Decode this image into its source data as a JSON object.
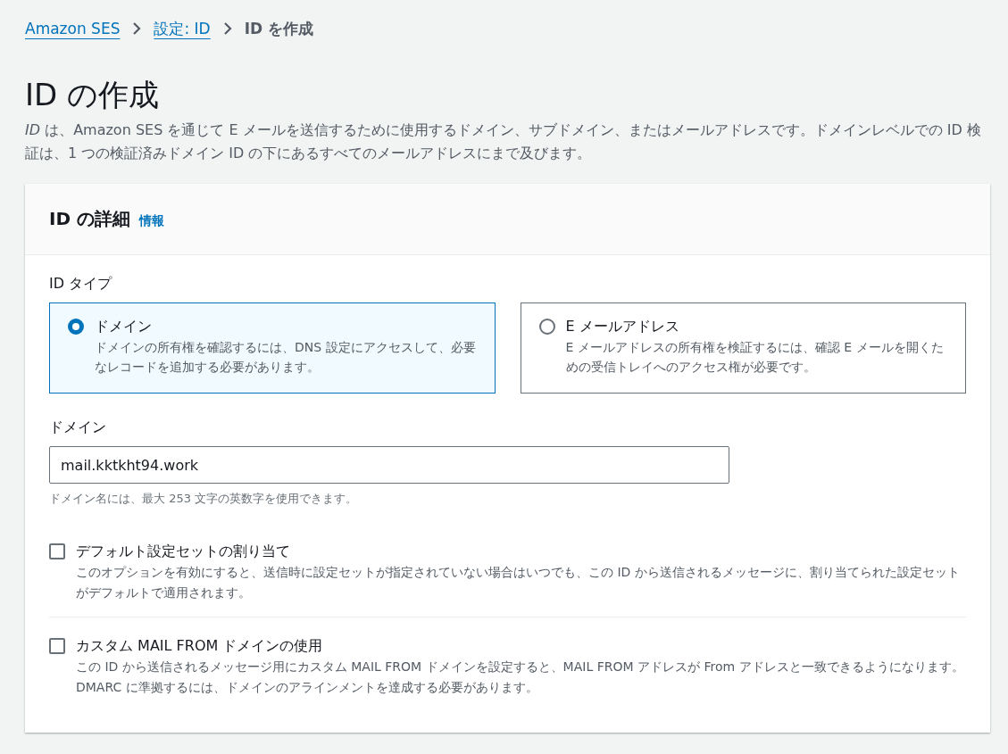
{
  "breadcrumbs": [
    {
      "label": "Amazon SES",
      "kind": "link"
    },
    {
      "label": "設定: ID",
      "kind": "link"
    },
    {
      "label": "ID を作成",
      "kind": "current"
    }
  ],
  "page": {
    "title": "ID の作成",
    "description": "*ID* は、Amazon SES を通じて E メールを送信するために使用するドメイン、サブドメイン、またはメールアドレスです。ドメインレベルでの ID 検証は、1 つの検証済みドメイン ID の下にあるすべてのメールアドレスにまで及びます。"
  },
  "card": {
    "title": "ID の詳細",
    "info_link": "情報",
    "id_type": {
      "label": "ID タイプ",
      "options": [
        {
          "label": "ドメイン",
          "description": "ドメインの所有権を確認するには、DNS 設定にアクセスして、必要なレコードを追加する必要があります。",
          "selected": true
        },
        {
          "label": "E メールアドレス",
          "description": "E メールアドレスの所有権を検証するには、確認 E メールを開くための受信トレイへのアクセス権が必要です。",
          "selected": false
        }
      ]
    },
    "domain": {
      "label": "ドメイン",
      "value": "mail.kktkht94.work",
      "hint": "ドメイン名には、最大 253 文字の英数字を使用できます。"
    },
    "options": [
      {
        "label": "デフォルト設定セットの割り当て",
        "description": "このオプションを有効にすると、送信時に設定セットが指定されていない場合はいつでも、この ID から送信されるメッセージに、割り当てられた設定セットがデフォルトで適用されます。",
        "checked": false
      },
      {
        "label": "カスタム MAIL FROM ドメインの使用",
        "description": "この ID から送信されるメッセージ用にカスタム MAIL FROM ドメインを設定すると、MAIL FROM アドレスが From アドレスと一致できるようになります。DMARC に準拠するには、ドメインのアラインメントを達成する必要があります。",
        "checked": false
      }
    ]
  }
}
